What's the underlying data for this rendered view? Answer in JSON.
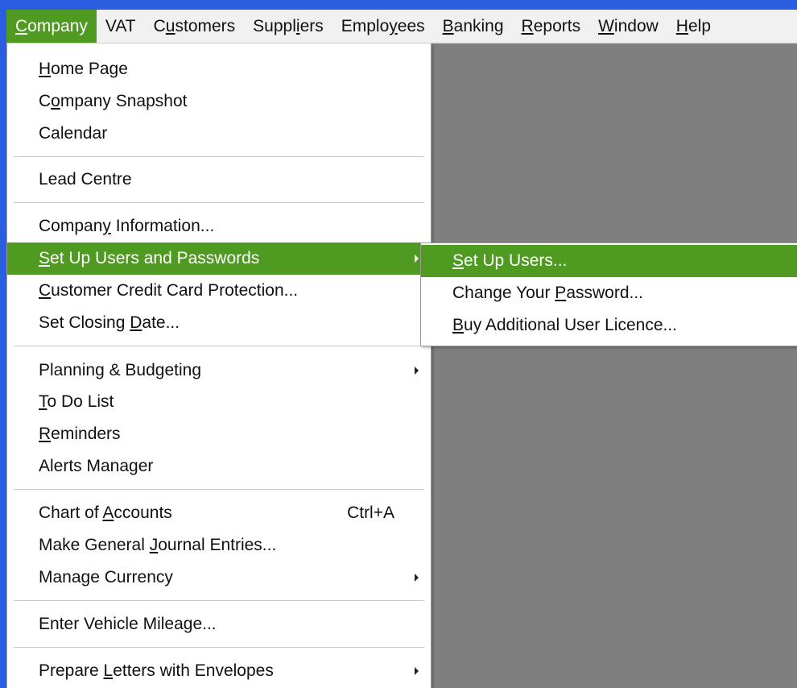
{
  "menubar": [
    {
      "pre": "",
      "u": "C",
      "post": "ompany"
    },
    {
      "pre": "VAT",
      "u": "",
      "post": ""
    },
    {
      "pre": "C",
      "u": "u",
      "post": "stomers"
    },
    {
      "pre": "Suppl",
      "u": "i",
      "post": "ers"
    },
    {
      "pre": "Emplo",
      "u": "y",
      "post": "ees"
    },
    {
      "pre": "",
      "u": "B",
      "post": "anking"
    },
    {
      "pre": "",
      "u": "R",
      "post": "eports"
    },
    {
      "pre": "",
      "u": "W",
      "post": "indow"
    },
    {
      "pre": "",
      "u": "H",
      "post": "elp"
    }
  ],
  "company_menu": [
    {
      "pre": "",
      "u": "H",
      "post": "ome Page",
      "shortcut": ""
    },
    {
      "pre": "C",
      "u": "o",
      "post": "mpany Snapshot",
      "shortcut": ""
    },
    {
      "pre": "Calendar",
      "u": "",
      "post": "",
      "shortcut": ""
    },
    {
      "pre": "Lead Centre",
      "u": "",
      "post": "",
      "shortcut": ""
    },
    {
      "pre": "Compan",
      "u": "y",
      "post": " Information...",
      "shortcut": ""
    },
    {
      "pre": "",
      "u": "S",
      "post": "et Up Users and Passwords",
      "shortcut": ""
    },
    {
      "pre": "",
      "u": "C",
      "post": "ustomer Credit Card Protection...",
      "shortcut": ""
    },
    {
      "pre": "Set Closing ",
      "u": "D",
      "post": "ate...",
      "shortcut": ""
    },
    {
      "pre": "Plannin",
      "u": "g",
      "post": " & Budgeting",
      "shortcut": ""
    },
    {
      "pre": "",
      "u": "T",
      "post": "o Do List",
      "shortcut": ""
    },
    {
      "pre": "",
      "u": "R",
      "post": "eminders",
      "shortcut": ""
    },
    {
      "pre": "Alerts Manager",
      "u": "",
      "post": "",
      "shortcut": ""
    },
    {
      "pre": "Chart of ",
      "u": "A",
      "post": "ccounts",
      "shortcut": "Ctrl+A"
    },
    {
      "pre": "Make General ",
      "u": "J",
      "post": "ournal Entries...",
      "shortcut": ""
    },
    {
      "pre": "Manage Currency",
      "u": "",
      "post": "",
      "shortcut": ""
    },
    {
      "pre": "Enter Vehicle Mileage...",
      "u": "",
      "post": "",
      "shortcut": ""
    },
    {
      "pre": "Prepare ",
      "u": "L",
      "post": "etters with Envelopes",
      "shortcut": ""
    }
  ],
  "submenu": [
    {
      "pre": "",
      "u": "S",
      "post": "et Up Users..."
    },
    {
      "pre": "Change Your ",
      "u": "P",
      "post": "assword..."
    },
    {
      "pre": "",
      "u": "B",
      "post": "uy Additional User Licence..."
    }
  ]
}
